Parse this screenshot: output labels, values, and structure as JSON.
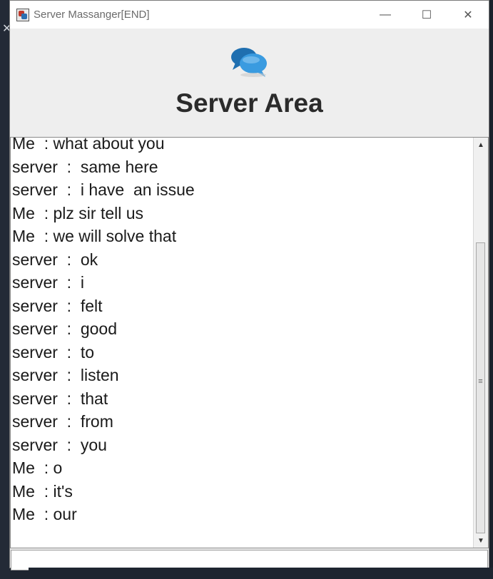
{
  "window": {
    "title": "Server Massanger[END]",
    "controls": {
      "minimize": "—",
      "maximize": "☐",
      "close": "✕"
    }
  },
  "header": {
    "icon": "chat-bubbles-icon",
    "heading": "Server Area"
  },
  "messages": [
    "Me  : what about you",
    "server  :  same here",
    "server  :  i have  an issue",
    "Me  : plz sir tell us",
    "Me  : we will solve that",
    "server  :  ok",
    "server  :  i",
    "server  :  felt",
    "server  :  good",
    "server  :  to",
    "server  :  listen",
    "server  :  that",
    "server  :  from",
    "server  :  you",
    "Me  : o",
    "Me  : it's",
    "Me  : our"
  ],
  "input": {
    "value": "",
    "placeholder": ""
  },
  "colors": {
    "heading": "#2b2b2b",
    "bubble_front": "#2f8fd8",
    "bubble_back": "#1f6fb0"
  }
}
